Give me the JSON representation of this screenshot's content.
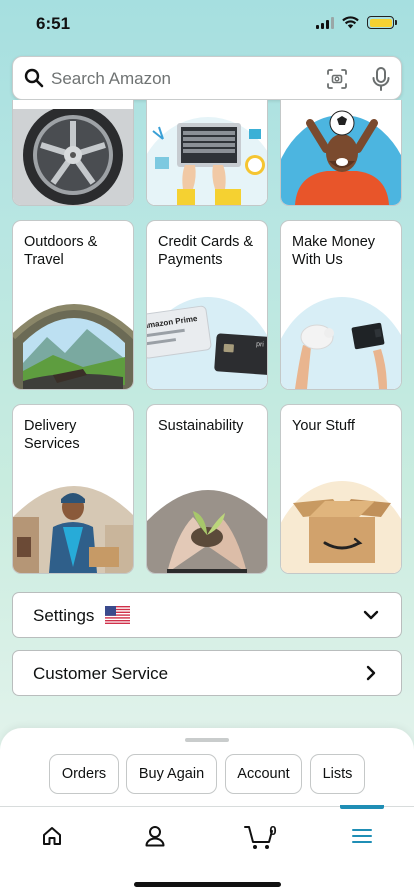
{
  "status_bar": {
    "time": "6:51",
    "battery_color": "#f5d131"
  },
  "search": {
    "placeholder": "Search Amazon",
    "value": ""
  },
  "top_cards": [
    {
      "name": "wheels",
      "image": "alloy-wheels-image"
    },
    {
      "name": "office",
      "image": "laptop-desk-image"
    },
    {
      "name": "sports",
      "image": "soccer-fan-image"
    }
  ],
  "cards": [
    {
      "title": "Outdoors & Travel",
      "image": "tent-mountain-view-image"
    },
    {
      "title": "Credit Cards & Payments",
      "image": "amazon-prime-credit-cards-image",
      "card_text": "amazon Prime"
    },
    {
      "title": "Make Money With Us",
      "image": "piggy-bank-wallet-image"
    },
    {
      "title": "Delivery Services",
      "image": "delivery-driver-image"
    },
    {
      "title": "Sustainability",
      "image": "seedling-hands-image"
    },
    {
      "title": "Your Stuff",
      "image": "amazon-box-image"
    }
  ],
  "settings": {
    "label": "Settings",
    "flag": "us-flag-icon"
  },
  "customer_service": {
    "label": "Customer Service"
  },
  "quick_actions": [
    "Orders",
    "Buy Again",
    "Account",
    "Lists"
  ],
  "bottom_nav": {
    "cart_count": "0",
    "active_item": "menu",
    "accent_color": "#1f8eb5"
  }
}
